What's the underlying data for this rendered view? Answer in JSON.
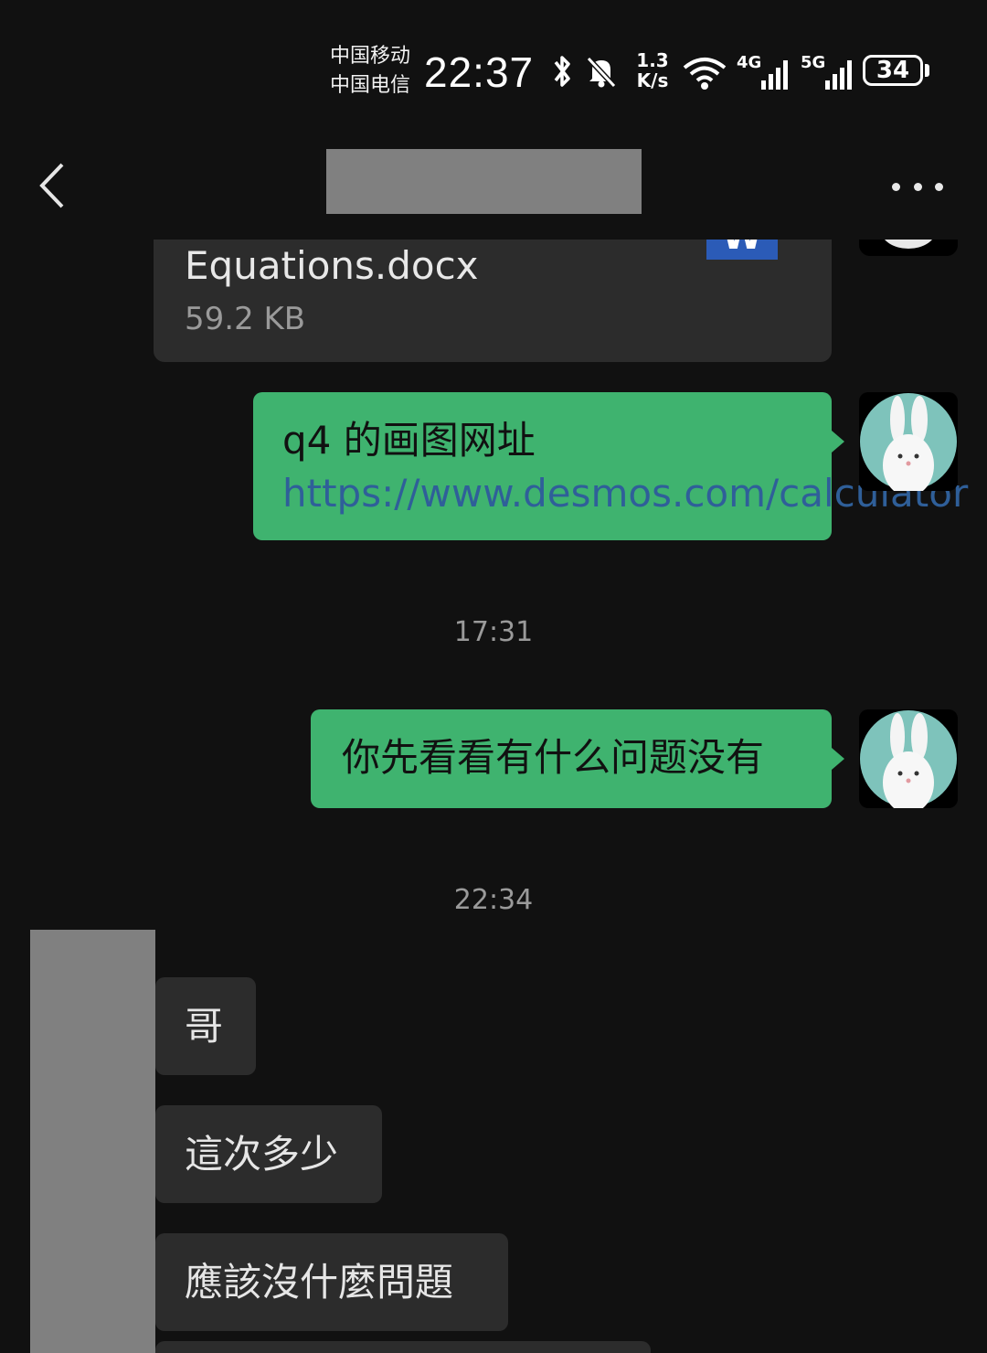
{
  "status_bar": {
    "carrier_1": "中国移动",
    "carrier_2": "中国电信",
    "time": "22:37",
    "net_speed_value": "1.3",
    "net_speed_unit": "K/s",
    "signal_1_label": "4G",
    "signal_2_label": "5G",
    "battery_level": "34",
    "icons": [
      "bluetooth-icon",
      "bell-off-icon",
      "wifi-icon",
      "signal-icon",
      "battery-icon"
    ]
  },
  "nav": {
    "back_icon": "chevron-left-icon",
    "more_icon": "more-horizontal-icon"
  },
  "messages": {
    "file": {
      "name": "Equations.docx",
      "size": "59.2 KB",
      "icon_letter": "W"
    },
    "me_1": {
      "text": "q4 的画图网址 ",
      "link": "https://www.desmos.com/calculator"
    },
    "timestamp_1": "17:31",
    "me_2": {
      "text": "你先看看有什么问题没有"
    },
    "timestamp_2": "22:34",
    "them": [
      "哥",
      "這次多少",
      "應該沒什麼問題"
    ]
  },
  "colors": {
    "background": "#111111",
    "my_bubble": "#3fb36f",
    "their_bubble": "#2c2c2c",
    "link": "#2f5f99",
    "word_blue": "#2b5bb7"
  }
}
